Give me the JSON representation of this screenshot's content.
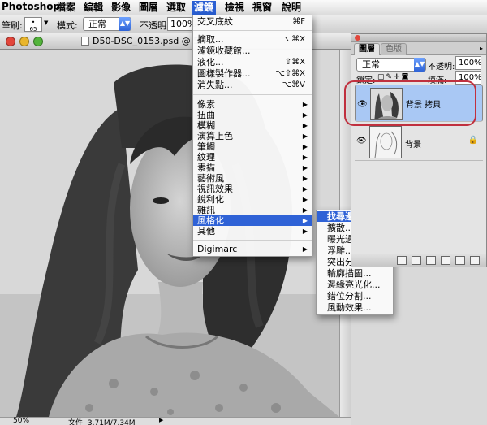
{
  "app": {
    "name": "Photoshop"
  },
  "menubar": {
    "items": [
      "檔案",
      "編輯",
      "影像",
      "圖層",
      "選取",
      "濾鏡",
      "檢視",
      "視窗",
      "說明"
    ],
    "active_index": 5
  },
  "options": {
    "brush_label": "筆刷:",
    "brush_size": "65",
    "mode_label": "模式:",
    "mode_value": "正常",
    "opacity_label": "不透明:",
    "opacity_value": "100%"
  },
  "document": {
    "title": "D50-DSC_0153.psd @ 50%",
    "zoom": "50%",
    "file_info": "文件: 3.71M/7.34M"
  },
  "filter_menu": {
    "items": [
      {
        "label": "交叉底紋",
        "shortcut": "⌘F"
      },
      {
        "label": "摘取...",
        "shortcut": "⌥⌘X"
      },
      {
        "label": "濾鏡收藏館..."
      },
      {
        "label": "液化...",
        "shortcut": "⇧⌘X"
      },
      {
        "label": "圖樣製作器...",
        "shortcut": "⌥⇧⌘X"
      },
      {
        "label": "消失點...",
        "shortcut": "⌥⌘V"
      },
      {
        "label": "像素"
      },
      {
        "label": "扭曲"
      },
      {
        "label": "模糊"
      },
      {
        "label": "演算上色"
      },
      {
        "label": "筆觸"
      },
      {
        "label": "紋理"
      },
      {
        "label": "素描"
      },
      {
        "label": "藝術風"
      },
      {
        "label": "視訊效果"
      },
      {
        "label": "銳利化"
      },
      {
        "label": "雜訊"
      },
      {
        "label": "風格化"
      },
      {
        "label": "其他"
      },
      {
        "label": "Digimarc"
      }
    ],
    "highlighted": "風格化"
  },
  "stylize_submenu": {
    "items": [
      "找尋邊緣",
      "擴散...",
      "曝光過度",
      "浮雕...",
      "突出分割...",
      "輪廓描圖...",
      "邊緣亮光化...",
      "錯位分割...",
      "風動效果..."
    ],
    "highlighted": "找尋邊緣"
  },
  "layers_panel": {
    "tabs": [
      "圖層",
      "色版"
    ],
    "blend_mode": "正常",
    "opacity_label": "不透明:",
    "opacity_value": "100%",
    "lock_label": "鎖定:",
    "fill_label": "填滿:",
    "fill_value": "100%",
    "layers": [
      {
        "name": "背景 拷貝",
        "selected": true
      },
      {
        "name": "背景",
        "selected": false
      }
    ]
  },
  "colors": {
    "accent": "#2f62d6",
    "selection": "#a9c8f4",
    "callout": "#c0303e"
  }
}
